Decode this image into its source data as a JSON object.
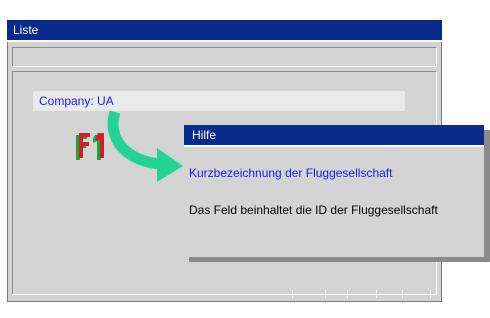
{
  "window": {
    "title": "Liste"
  },
  "field": {
    "label": "Company:",
    "value": "UA"
  },
  "help_popup": {
    "title": "Hilfe",
    "heading": "Kurzbezeichnung der Fluggesellschaft",
    "body": "Das Feld beinhaltet die ID der Fluggesellschaft"
  },
  "icons": {
    "help_key": "f1-key-icon",
    "arrow": "curved-arrow-icon"
  },
  "colors": {
    "titlebar": "#0a2a8c",
    "window_bg": "#d4d4d4",
    "field_text": "#1a1aee",
    "arrow": "#21d495",
    "f1_red": "#d01f2a",
    "f1_green": "#1fa23a"
  }
}
